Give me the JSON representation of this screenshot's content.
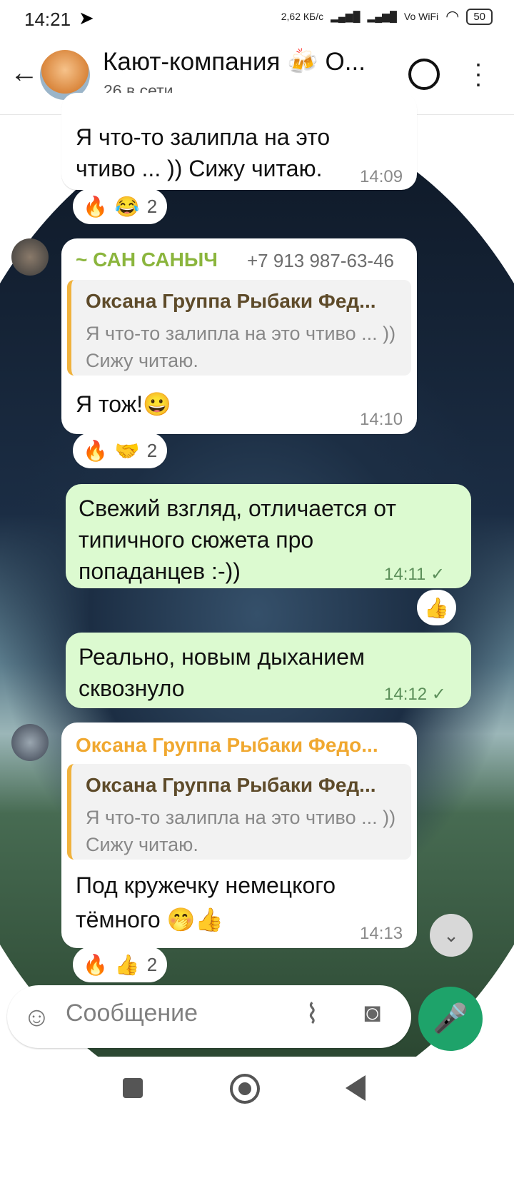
{
  "status": {
    "time": "14:21",
    "net_speed": "2,62 КБ/с",
    "network": "Vo WiFi",
    "battery": "50"
  },
  "header": {
    "title": "Кают-компания 🍻 О...",
    "subtitle": "26 в сети"
  },
  "messages": [
    {
      "text": "Я что-то залипла на это чтиво ... )) Сижу читаю.",
      "time": "14:09",
      "reactions": {
        "emoji1": "🔥",
        "emoji2": "😂",
        "count": "2"
      }
    },
    {
      "sender": "~ САН САНЫЧ",
      "phone": "+7 913 987-63-46",
      "quote": {
        "name": "Оксана Группа Рыбаки Фед...",
        "text": "Я что-то залипла на это чтиво ... )) Сижу читаю."
      },
      "text": "Я тож!😀",
      "time": "14:10",
      "reactions": {
        "emoji1": "🔥",
        "emoji2": "🤝",
        "count": "2"
      }
    },
    {
      "text": "Свежий взгляд, отличается от типичного сюжета про попаданцев :-))",
      "time": "14:11 ✓",
      "reactions": {
        "emoji1": "👍"
      }
    },
    {
      "text": "Реально, новым дыханием сквознуло",
      "time": "14:12 ✓"
    },
    {
      "sender": "Оксана Группа Рыбаки Федо...",
      "quote": {
        "name": "Оксана Группа Рыбаки Фед...",
        "text": "Я что-то залипла на это чтиво ... )) Сижу читаю."
      },
      "text": "Под кружечку немецкого тёмного 🤭👍",
      "time": "14:13",
      "reactions": {
        "emoji1": "🔥",
        "emoji2": "👍",
        "count": "2"
      }
    }
  ],
  "input": {
    "placeholder": "Сообщение"
  },
  "colors": {
    "sender_green": "#8bb53d",
    "sender_orange": "#f0a830",
    "own_bubble": "#dcfad0",
    "fab": "#1ea36a"
  }
}
